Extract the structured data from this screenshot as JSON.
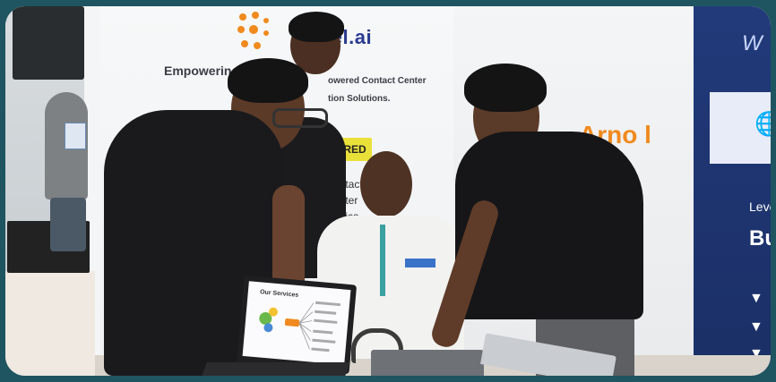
{
  "photo": {
    "booth_banner": {
      "brand": "otel.ai",
      "tagline": "Empowering t",
      "tagline_right_1": "owered Contact Center",
      "tagline_right_2": "tion Solutions.",
      "badge": "WERED",
      "fragment_lines": [
        "ontact",
        "enter",
        "unica"
      ]
    },
    "second_banner": {
      "brand_fragment": "Arno l"
    },
    "right_panel": {
      "welcome_fragment": "W",
      "line1": "Leve",
      "line2": "Bu"
    },
    "laptop_slide": {
      "title": "Our Services"
    },
    "colors": {
      "background": "#1f5560",
      "brand_blue": "#2a3b8f",
      "accent_orange": "#f08a1e",
      "badge_yellow": "#e9e13a",
      "panel_navy": "#1b2f66"
    }
  }
}
